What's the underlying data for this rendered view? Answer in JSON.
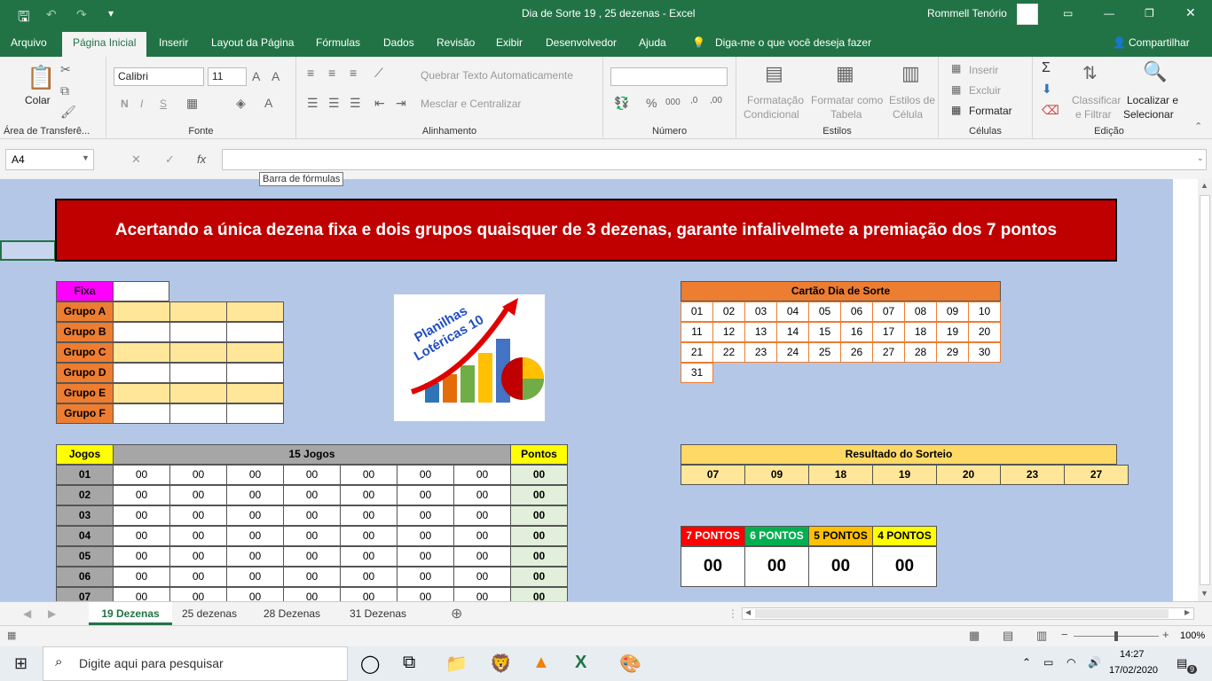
{
  "window": {
    "title": "Dia de Sorte 19 , 25 dezenas  -  Excel",
    "user": "Rommell Tenório"
  },
  "menu": {
    "tabs": [
      "Arquivo",
      "Página Inicial",
      "Inserir",
      "Layout da Página",
      "Fórmulas",
      "Dados",
      "Revisão",
      "Exibir",
      "Desenvolvedor",
      "Ajuda"
    ],
    "tellme": "Diga-me o que você deseja fazer",
    "share": "Compartilhar"
  },
  "ribbon": {
    "clipboard": {
      "paste": "Colar",
      "label": "Área de Transferê..."
    },
    "font": {
      "name": "Calibri",
      "size": "11",
      "bold": "N",
      "italic": "I",
      "underline": "S",
      "label": "Fonte"
    },
    "align": {
      "wrap": "Quebrar Texto Automaticamente",
      "merge": "Mesclar e Centralizar",
      "label": "Alinhamento"
    },
    "number": {
      "label": "Número"
    },
    "styles": {
      "cond1": "Formatação",
      "cond2": "Condicional",
      "table1": "Formatar como",
      "table2": "Tabela",
      "cell1": "Estilos de",
      "cell2": "Célula",
      "label": "Estilos"
    },
    "cells": {
      "insert": "Inserir",
      "delete": "Excluir",
      "format": "Formatar",
      "label": "Células"
    },
    "edit": {
      "sort1": "Classificar",
      "sort2": "e Filtrar",
      "find1": "Localizar e",
      "find2": "Selecionar",
      "label": "Edição"
    }
  },
  "formula": {
    "namebox": "A4",
    "tooltip": "Barra de fórmulas"
  },
  "sheet": {
    "banner": "Acertando a única dezena fixa e dois grupos quaisquer de 3 dezenas, garante infalivelmete a premiação dos 7 pontos",
    "groups": {
      "fixa": "Fixa",
      "rows": [
        "Grupo A",
        "Grupo B",
        "Grupo C",
        "Grupo D",
        "Grupo E",
        "Grupo F"
      ]
    },
    "logo": {
      "line1": "Planilhas",
      "line2": "Lotéricas 10"
    },
    "card": {
      "title": "Cartão Dia de Sorte",
      "numbers": [
        "01",
        "02",
        "03",
        "04",
        "05",
        "06",
        "07",
        "08",
        "09",
        "10",
        "11",
        "12",
        "13",
        "14",
        "15",
        "16",
        "17",
        "18",
        "19",
        "20",
        "21",
        "22",
        "23",
        "24",
        "25",
        "26",
        "27",
        "28",
        "29",
        "30",
        "31"
      ]
    },
    "games": {
      "h_jogos": "Jogos",
      "h_title": "15 Jogos",
      "h_pontos": "Pontos",
      "rows": [
        "01",
        "02",
        "03",
        "04",
        "05",
        "06",
        "07"
      ],
      "cell": "00"
    },
    "result": {
      "title": "Resultado do Sorteio",
      "numbers": [
        "07",
        "09",
        "18",
        "19",
        "20",
        "23",
        "27"
      ]
    },
    "points": {
      "labels": [
        "7 PONTOS",
        "6 PONTOS",
        "5 PONTOS",
        "4 PONTOS"
      ],
      "colors": [
        "#ff0000",
        "#00b050",
        "#ffc000",
        "#ffff00"
      ],
      "values": [
        "00",
        "00",
        "00",
        "00"
      ]
    }
  },
  "sheettabs": [
    "19 Dezenas",
    "25 dezenas",
    "28 Dezenas",
    "31 Dezenas"
  ],
  "status": {
    "zoom": "100%"
  },
  "taskbar": {
    "search": "Digite aqui para pesquisar",
    "time": "14:27",
    "date": "17/02/2020",
    "notif": "9"
  }
}
